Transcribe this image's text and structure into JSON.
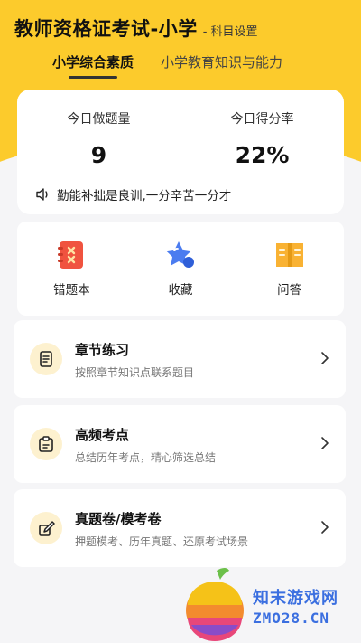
{
  "header": {
    "title": "教师资格证考试-小学",
    "subject_setting": "- 科目设置"
  },
  "tabs": [
    {
      "label": "小学综合素质",
      "active": true
    },
    {
      "label": "小学教育知识与能力",
      "active": false
    }
  ],
  "stats": {
    "today_count_label": "今日做题量",
    "today_count_value": "9",
    "score_rate_label": "今日得分率",
    "score_rate_value": "22%",
    "motto": "勤能补拙是良训,一分辛苦一分才"
  },
  "shortcuts": [
    {
      "label": "错题本",
      "icon": "wrong-book-icon"
    },
    {
      "label": "收藏",
      "icon": "star-icon"
    },
    {
      "label": "问答",
      "icon": "qa-book-icon"
    }
  ],
  "list": [
    {
      "title": "章节练习",
      "subtitle": "按照章节知识点联系题目",
      "icon": "document-icon"
    },
    {
      "title": "高频考点",
      "subtitle": "总结历年考点，精心筛选总结",
      "icon": "clipboard-icon"
    },
    {
      "title": "真题卷/模考卷",
      "subtitle": "押题模考、历年真题、还原考试场景",
      "icon": "pen-paper-icon"
    }
  ],
  "watermark": {
    "text_cn": "知末游戏网",
    "text_en": "ZMO28.CN"
  },
  "colors": {
    "brand_yellow": "#fccb2c",
    "icon_red": "#f0533f",
    "icon_blue": "#4b7cf0",
    "icon_orange": "#f9b233",
    "watermark_blue": "#3b6fe0"
  }
}
